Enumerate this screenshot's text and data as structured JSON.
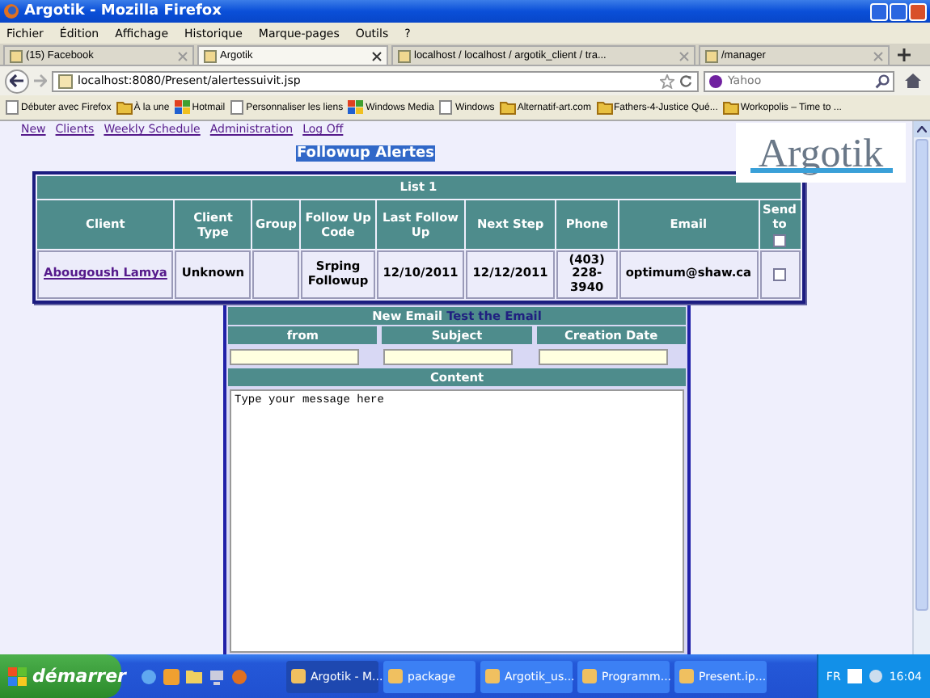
{
  "window": {
    "title": "Argotik - Mozilla Firefox"
  },
  "menu": [
    "Fichier",
    "Édition",
    "Affichage",
    "Historique",
    "Marque-pages",
    "Outils",
    "?"
  ],
  "tabs": [
    {
      "label": "(15) Facebook",
      "selected": false
    },
    {
      "label": "Argotik",
      "selected": true
    },
    {
      "label": "localhost / localhost / argotik_client / tra...",
      "selected": false
    },
    {
      "label": "/manager",
      "selected": false
    }
  ],
  "address_bar": {
    "url": "localhost:8080/Present/alertessuivit.jsp"
  },
  "search": {
    "placeholder": "Yahoo"
  },
  "bookmarks": [
    {
      "label": "Débuter avec Firefox",
      "kind": "page"
    },
    {
      "label": "À la une",
      "kind": "folder"
    },
    {
      "label": "Hotmail",
      "kind": "flag"
    },
    {
      "label": "Personnaliser les liens",
      "kind": "page"
    },
    {
      "label": "Windows Media",
      "kind": "flag"
    },
    {
      "label": "Windows",
      "kind": "page"
    },
    {
      "label": "Alternatif-art.com",
      "kind": "folder"
    },
    {
      "label": "Fathers-4-Justice Qué...",
      "kind": "folder"
    },
    {
      "label": "Workopolis – Time to ...",
      "kind": "folder"
    }
  ],
  "page": {
    "nav_links": [
      "New",
      "Clients",
      "Weekly Schedule",
      "Administration",
      "Log Off"
    ],
    "heading": "Followup Alertes",
    "logo": "Argotik",
    "list": {
      "title": "List 1",
      "columns": [
        "Client",
        "Client Type",
        "Group",
        "Follow Up Code",
        "Last Follow Up",
        "Next Step",
        "Phone",
        "Email",
        "Send to"
      ],
      "send_to_all_checked": false,
      "rows": [
        {
          "client": "Abougoush Lamya",
          "client_type": "Unknown",
          "follow_up_code": "Srping Followup",
          "last_follow_up": "12/10/2011",
          "next_step": "12/12/2011",
          "phone": "(403) 228-3940",
          "email": "optimum@shaw.ca",
          "checked": false
        }
      ]
    },
    "email": {
      "title": "New Email",
      "test_link": "Test the Email",
      "fields": [
        "from",
        "Subject",
        "Creation Date"
      ],
      "content_label": "Content",
      "message": "Type your message here"
    }
  },
  "taskbar": {
    "start": "démarrer",
    "tasks": [
      {
        "label": "Argotik - M...",
        "selected": true
      },
      {
        "label": "package",
        "selected": false
      },
      {
        "label": "Argotik_us...",
        "selected": false
      },
      {
        "label": "Programm...",
        "selected": false
      },
      {
        "label": "Present.ip...",
        "selected": false
      }
    ],
    "language": "FR",
    "clock": "16:04"
  }
}
